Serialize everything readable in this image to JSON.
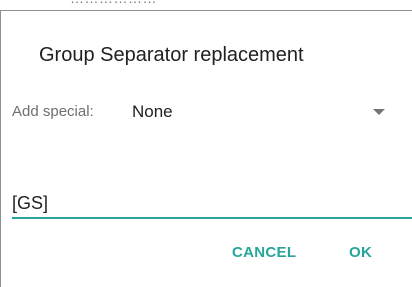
{
  "background": {
    "partial_text": "………………"
  },
  "dialog": {
    "title": "Group Separator replacement",
    "add_special": {
      "label": "Add special:",
      "selected_value": "None",
      "arrow_icon": "dropdown-arrow-icon"
    },
    "input": {
      "value": "[GS]"
    },
    "buttons": {
      "cancel_label": "CANCEL",
      "ok_label": "OK"
    }
  },
  "colors": {
    "accent": "#26a69a",
    "title_text": "#212121",
    "label_text": "#6f6f6f",
    "arrow": "#757575"
  }
}
